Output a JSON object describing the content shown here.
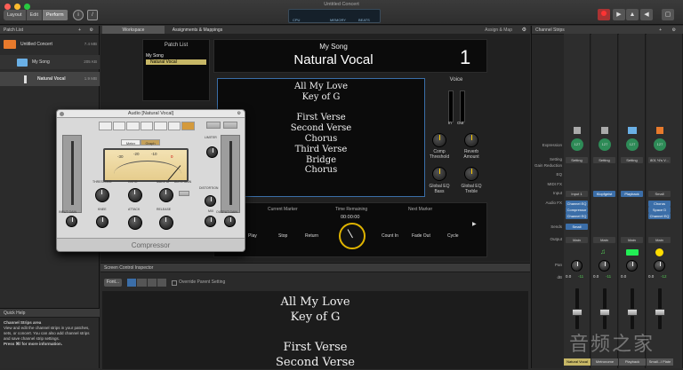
{
  "window": {
    "title": "Untitled Concert"
  },
  "toolbar": {
    "modes": [
      "Layout",
      "Edit",
      "Perform"
    ],
    "active_mode": "Perform"
  },
  "patch_list": {
    "header": "Patch List",
    "items": [
      {
        "name": "Untitled Concert",
        "size": "7.4 MB"
      },
      {
        "name": "My Song",
        "size": "205 KB"
      },
      {
        "name": "Natural Vocal",
        "size": "1.9 MB"
      }
    ]
  },
  "tabs": {
    "workspace": "Workspace",
    "assignments": "Assignments & Mappings",
    "assign_map": "Assign & Map"
  },
  "perform": {
    "patch_list_title": "Patch List",
    "patches": [
      "My Song",
      "Natural Vocal"
    ],
    "song": "My Song",
    "patch": "Natural Vocal",
    "number": "1",
    "lyrics": [
      "All My Love",
      "Key of G",
      "",
      "First Verse",
      "Second Verse",
      "Chorus",
      "Third Verse",
      "Bridge",
      "Chorus"
    ],
    "voice_title": "Voice",
    "in": "In",
    "out": "Out",
    "knobs": [
      "Comp Threshold",
      "Reverb Amount",
      "Global EQ Bass",
      "Global EQ Treble"
    ],
    "transport": {
      "current_marker": "Current Marker",
      "time_remaining": "Time Remaining",
      "time": "00:00:00",
      "next_marker": "Next Marker"
    },
    "buttons": [
      "Play",
      "Stop",
      "Return",
      "Count In",
      "Fade Out",
      "Cycle"
    ]
  },
  "plugin": {
    "title": "Audio [Natural Vocal]",
    "name": "Compressor",
    "meter_modes": [
      "Meter",
      "Graph"
    ],
    "knob_labels": [
      "THRESHOLD",
      "RATIO",
      "MAKE UP",
      "AUTO GAIN",
      "KNEE",
      "ATTACK",
      "RELEASE",
      "DISTORTION",
      "MIX",
      "INPUT GAIN",
      "OUTPUT GAIN"
    ],
    "ticks": [
      "-30",
      "-20",
      "-10",
      "0"
    ]
  },
  "inspector": {
    "header": "Screen Control Inspector",
    "font_btn": "Font...",
    "override": "Override Parent Setting",
    "lyrics": [
      "All My Love",
      "Key of G",
      "",
      "First Verse",
      "Second Verse"
    ]
  },
  "quick_help": {
    "header": "Quick Help",
    "title": "Channel Strips area",
    "body": "View and edit the channel strips in your patches, sets, or concert. You can also add channel strips and save channel strip settings.",
    "more": "Press ⌘/ for more information."
  },
  "channel_strips": {
    "header": "Channel Strips",
    "row_labels": [
      "Expression",
      "Setting",
      "Gain Reduction",
      "EQ",
      "MIDI FX",
      "Input",
      "Audio FX",
      "Sends",
      "Output",
      "Pan",
      "dB"
    ],
    "strips": [
      {
        "setting": "Setting",
        "input": "Input 1",
        "fx": [
          "Channel EQ",
          "Compressor",
          "Channel EQ"
        ],
        "send": "Small",
        "output": "Main",
        "db": "0.0",
        "db2": "-11",
        "name": "Natural Vocal",
        "value": "127"
      },
      {
        "setting": "Setting",
        "input": "Klopfgeist",
        "fx": [],
        "send": "",
        "output": "Main",
        "db": "0.0",
        "db2": "-11",
        "name": "Metronome",
        "value": "127"
      },
      {
        "setting": "Setting",
        "input": "Playback",
        "fx": [],
        "send": "",
        "output": "Main",
        "db": "0.0",
        "db2": "",
        "name": "Playback",
        "value": "127"
      },
      {
        "setting": "801 ½'s V...",
        "input": "Small",
        "fx": [
          "Chorus",
          "Space D",
          "Channel EQ"
        ],
        "send": "",
        "output": "Main",
        "db": "0.0",
        "db2": "-12",
        "name": "Small...l Plate",
        "value": "127"
      }
    ]
  },
  "watermark": "音频之家"
}
